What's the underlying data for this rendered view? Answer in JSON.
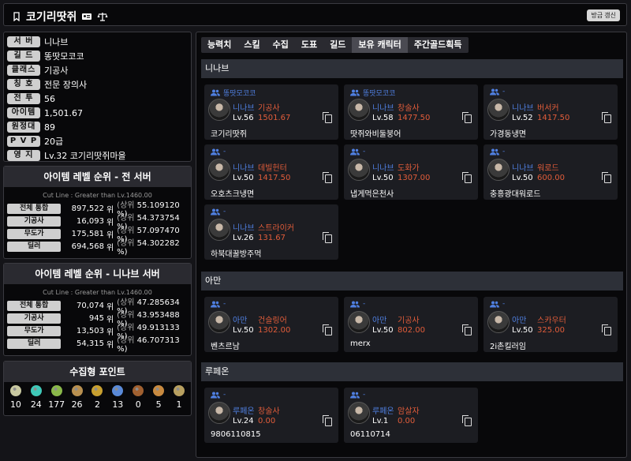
{
  "header": {
    "title": "코기리땃쥐",
    "refresh_label": "방금 갱신"
  },
  "info": [
    {
      "label": "서 버",
      "value": "니나브"
    },
    {
      "label": "길 드",
      "value": "똥땃모코코"
    },
    {
      "label": "클래스",
      "value": "기공사"
    },
    {
      "label": "칭 호",
      "value": "전문 장의사"
    },
    {
      "label": "전 투",
      "value": "56"
    },
    {
      "label": "아이템",
      "value": "1,501.67"
    },
    {
      "label": "원정대",
      "value": "89"
    },
    {
      "label": "P V P",
      "value": "20급"
    },
    {
      "label": "영 지",
      "value": "Lv.32 코기리땃쥐마을"
    }
  ],
  "rank_all": {
    "title": "아이템 레벨 순위 - 전 서버",
    "subtitle": "Cut Line : Greater than Lv.1460.00",
    "rows": [
      {
        "label": "전체 통합",
        "rank": "897,522",
        "unit": "위",
        "pct_prefix": "(상위",
        "pct": "55.109120 %)"
      },
      {
        "label": "기공사",
        "rank": "16,093",
        "unit": "위",
        "pct_prefix": "(상위",
        "pct": "54.373754 %)"
      },
      {
        "label": "무도가",
        "rank": "175,581",
        "unit": "위",
        "pct_prefix": "(상위",
        "pct": "57.097470 %)"
      },
      {
        "label": "딜러",
        "rank": "694,568",
        "unit": "위",
        "pct_prefix": "(상위",
        "pct": "54.302282 %)"
      }
    ]
  },
  "rank_server": {
    "title": "아이템 레벨 순위 - 니나브 서버",
    "subtitle": "Cut Line : Greater than Lv.1460.00",
    "rows": [
      {
        "label": "전체 통합",
        "rank": "70,074",
        "unit": "위",
        "pct_prefix": "(상위",
        "pct": "47.285634 %)"
      },
      {
        "label": "기공사",
        "rank": "945",
        "unit": "위",
        "pct_prefix": "(상위",
        "pct": "43.953488 %)"
      },
      {
        "label": "무도가",
        "rank": "13,503",
        "unit": "위",
        "pct_prefix": "(상위",
        "pct": "49.913133 %)"
      },
      {
        "label": "딜러",
        "rank": "54,315",
        "unit": "위",
        "pct_prefix": "(상위",
        "pct": "46.707313 %)"
      }
    ]
  },
  "collect": {
    "title": "수집형 포인트",
    "items": [
      {
        "icon": "mokoko-seed-icon",
        "color": "#c8c8a0",
        "value": "10"
      },
      {
        "icon": "island-heart-icon",
        "color": "#3fc8b8",
        "value": "24"
      },
      {
        "icon": "mokoko-icon",
        "color": "#8ab84a",
        "value": "177"
      },
      {
        "icon": "masterpiece-icon",
        "color": "#b89050",
        "value": "26"
      },
      {
        "icon": "adventure-tome-icon",
        "color": "#c8a030",
        "value": "2"
      },
      {
        "icon": "world-tree-leaf-icon",
        "color": "#5a8ad8",
        "value": "13"
      },
      {
        "icon": "ignea-token-icon",
        "color": "#a06030",
        "value": "0"
      },
      {
        "icon": "sea-bounty-icon",
        "color": "#c88a40",
        "value": "5"
      },
      {
        "icon": "giant-heart-icon",
        "color": "#b8a060",
        "value": "1"
      }
    ]
  },
  "tabs": [
    "능력치",
    "스킬",
    "수집",
    "도표",
    "길드",
    "보유 캐릭터",
    "주간골드획득"
  ],
  "active_tab": "보유 캐릭터",
  "groups": [
    {
      "server": "니나브",
      "characters": [
        {
          "guild": "똥땃모코코",
          "server": "니나브",
          "class": "기공사",
          "level": "Lv.56",
          "item_level": "1501.67",
          "name": "코기리땃쥐"
        },
        {
          "guild": "똥땃모코코",
          "server": "니나브",
          "class": "창술사",
          "level": "Lv.58",
          "item_level": "1477.50",
          "name": "땃쥐와비둘붕어"
        },
        {
          "guild": "-",
          "server": "니나브",
          "class": "버서커",
          "level": "Lv.52",
          "item_level": "1417.50",
          "name": "가경동냉면"
        },
        {
          "guild": "-",
          "server": "니나브",
          "class": "데빌헌터",
          "level": "Lv.50",
          "item_level": "1417.50",
          "name": "오호츠크냉면"
        },
        {
          "guild": "-",
          "server": "니나브",
          "class": "도화가",
          "level": "Lv.50",
          "item_level": "1307.00",
          "name": "냅게먹은천사"
        },
        {
          "guild": "-",
          "server": "니나브",
          "class": "워로드",
          "level": "Lv.50",
          "item_level": "600.00",
          "name": "충흥광대워로드"
        },
        {
          "guild": "-",
          "server": "니나브",
          "class": "스트라이커",
          "level": "Lv.26",
          "item_level": "131.67",
          "name": "하북대꿀방주먹"
        }
      ]
    },
    {
      "server": "아만",
      "characters": [
        {
          "guild": "-",
          "server": "아만",
          "class": "건슬링어",
          "level": "Lv.50",
          "item_level": "1302.00",
          "name": "벤츠르남"
        },
        {
          "guild": "-",
          "server": "아만",
          "class": "기공사",
          "level": "Lv.50",
          "item_level": "802.00",
          "name": "merx"
        },
        {
          "guild": "-",
          "server": "아만",
          "class": "스카우터",
          "level": "Lv.50",
          "item_level": "325.00",
          "name": "2i촌킬러임"
        }
      ]
    },
    {
      "server": "루페온",
      "characters": [
        {
          "guild": "-",
          "server": "루페온",
          "class": "창술사",
          "level": "Lv.24",
          "item_level": "0.00",
          "name": "9806110815"
        },
        {
          "guild": "-",
          "server": "루페온",
          "class": "암살자",
          "level": "Lv.1",
          "item_level": "0.00",
          "name": "06110714"
        }
      ]
    }
  ]
}
